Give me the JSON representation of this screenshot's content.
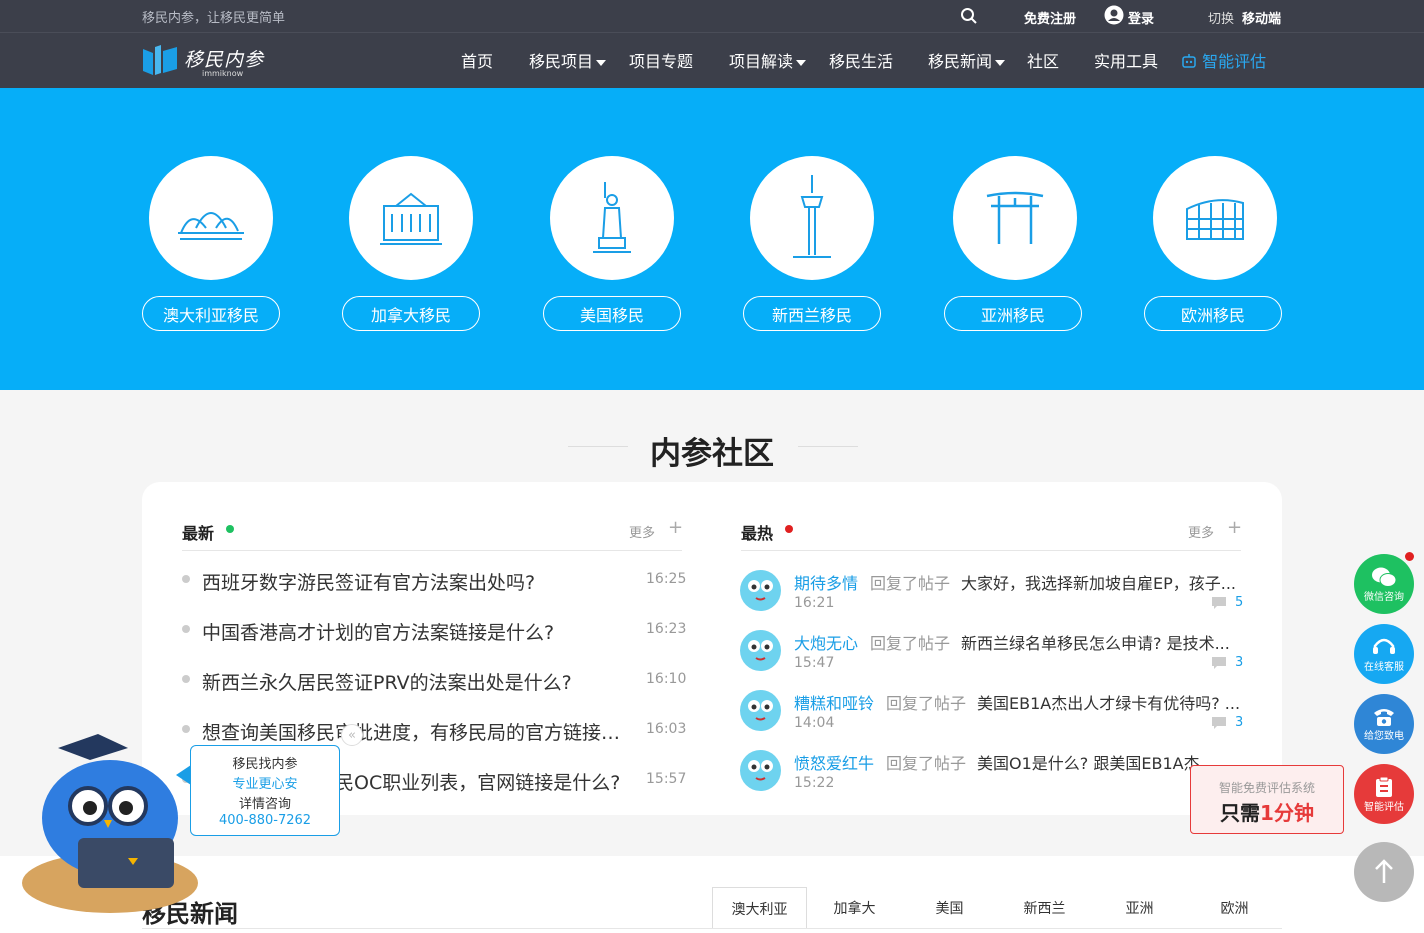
{
  "topbar": {
    "slogan": "移民内参，让移民更简单",
    "register": "免费注册",
    "login": "登录",
    "switch_prefix": "切换",
    "switch_mobile": "移动端"
  },
  "logo": {
    "text_cn": "移民内参",
    "text_en": "immiknow"
  },
  "nav": {
    "items": [
      "首页",
      "移民项目",
      "项目专题",
      "项目解读",
      "移民生活",
      "移民新闻",
      "社区",
      "实用工具",
      "智能评估"
    ]
  },
  "hero": {
    "regions": [
      "澳大利亚移民",
      "加拿大移民",
      "美国移民",
      "新西兰移民",
      "亚洲移民",
      "欧洲移民"
    ]
  },
  "community": {
    "title": "内参社区",
    "latest": {
      "heading": "最新",
      "more": "更多",
      "posts": [
        {
          "title": "西班牙数字游民签证有官方法案出处吗?",
          "time": "16:25"
        },
        {
          "title": "中国香港高才计划的官方法案链接是什么?",
          "time": "16:23"
        },
        {
          "title": "新西兰永久居民签证PRV的法案出处是什么?",
          "time": "16:10"
        },
        {
          "title": "想查询美国移民审批进度，有移民局的官方链接吗?",
          "time": "16:03"
        },
        {
          "title": "澳大利亚技术移民OC职业列表，官网链接是什么?",
          "time": "15:57"
        }
      ]
    },
    "hot": {
      "heading": "最热",
      "more": "更多",
      "reply_label": "回复了帖子",
      "posts": [
        {
          "user": "期待多情",
          "title": "大家好，我选择新加坡自雇EP，孩子...",
          "time": "16:21",
          "comments": "5"
        },
        {
          "user": "大炮无心",
          "title": "新西兰绿名单移民怎么申请? 是技术...",
          "time": "15:47",
          "comments": "3"
        },
        {
          "user": "糟糕和哑铃",
          "title": "美国EB1A杰出人才绿卡有优待吗? ...",
          "time": "14:04",
          "comments": "3"
        },
        {
          "user": "愤怒爱红牛",
          "title": "美国O1是什么? 跟美国EB1A杰出...",
          "time": "15:22",
          "comments": ""
        }
      ]
    }
  },
  "news": {
    "title": "移民新闻",
    "tabs": [
      "澳大利亚",
      "加拿大",
      "美国",
      "新西兰",
      "亚洲",
      "欧洲"
    ]
  },
  "mascot": {
    "line1": "移民找内参",
    "line2": "专业更心安",
    "line3": "详情咨询",
    "phone": "400-880-7262"
  },
  "float": {
    "wechat": "微信咨询",
    "service": "在线客服",
    "call": "给您致电",
    "assess": "智能评估",
    "promo_small": "智能免费评估系统",
    "promo_prefix": "只需",
    "promo_highlight": "1分钟"
  },
  "colors": {
    "hero_bg": "#06aef8",
    "nav_bg": "#3c3f4a",
    "link_blue": "#1a9ee6",
    "wechat_green": "#1ec161",
    "call_blue": "#2f86d6",
    "assess_red": "#e63a3a"
  }
}
